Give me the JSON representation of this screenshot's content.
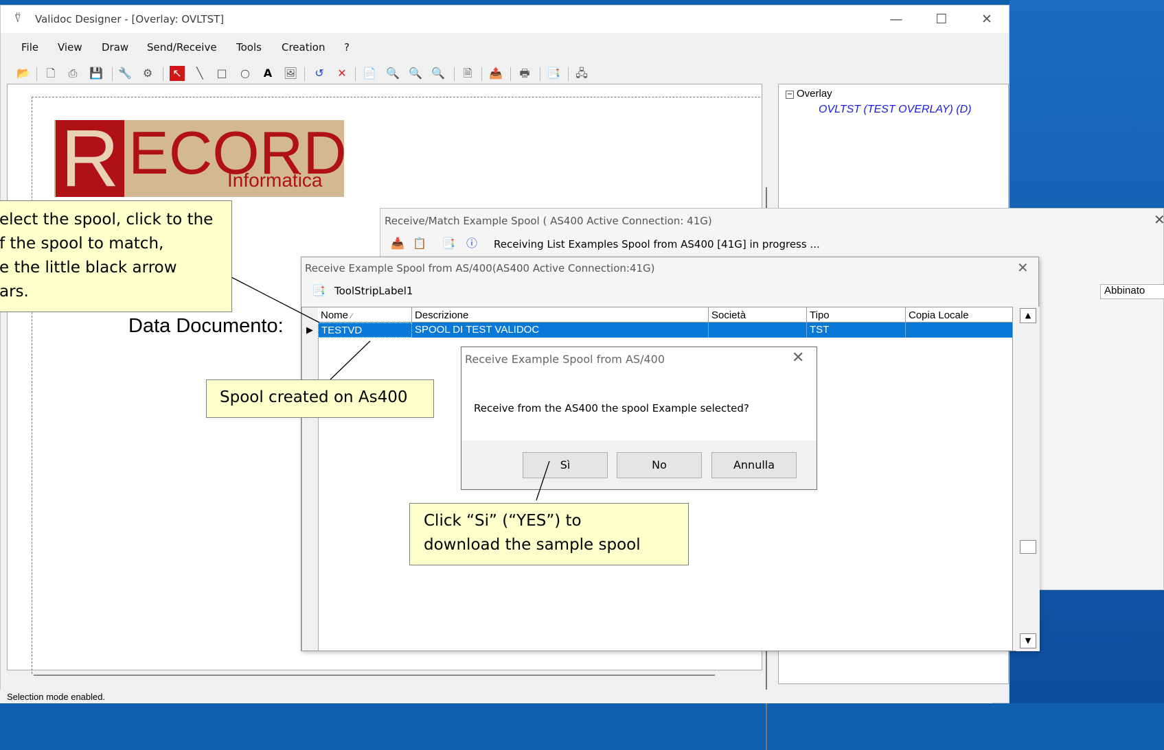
{
  "window": {
    "title": "Validoc Designer - [Overlay: OVLTST]",
    "app_icon": "validoc-icon"
  },
  "menu": [
    "File",
    "View",
    "Draw",
    "Send/Receive",
    "Tools",
    "Creation",
    "?"
  ],
  "canvas": {
    "logo_r": "R",
    "logo_ecord": "ECORD",
    "logo_sub": "Informatica",
    "data_label": "Data Documento:"
  },
  "tree": {
    "root": "Overlay",
    "child": "OVLTST (TEST OVERLAY) (D)"
  },
  "status": "Selection mode enabled.",
  "dialog_back": {
    "title": "Receive/Match Example Spool ( AS400 Active Connection: 41G)",
    "status": "Receiving List Examples Spool from AS400 [41G] in progress ...",
    "column_abbinato": "Abbinato"
  },
  "dialog_front": {
    "title": "Receive Example Spool from AS/400(AS400 Active Connection:41G)",
    "tool_label": "ToolStripLabel1",
    "columns": [
      "Nome",
      "Descrizione",
      "Società",
      "Tipo",
      "Copia Locale"
    ],
    "rows": [
      {
        "nome": "TESTVD",
        "descrizione": "SPOOL DI TEST VALIDOC",
        "societa": "",
        "tipo": "TST",
        "copia": ""
      }
    ]
  },
  "msgbox": {
    "title": "Receive Example Spool from AS/400",
    "text": "Receive from the AS400 the spool Example selected?",
    "yes": "Sì",
    "no": "No",
    "cancel": "Annulla"
  },
  "callouts": {
    "select": [
      "elect the spool, click to the",
      "f the spool to match,",
      "e the little black arrow",
      "ars."
    ],
    "spool": "Spool created on As400",
    "click": [
      "Click “Si” (“YES”) to",
      "download the sample spool"
    ]
  }
}
